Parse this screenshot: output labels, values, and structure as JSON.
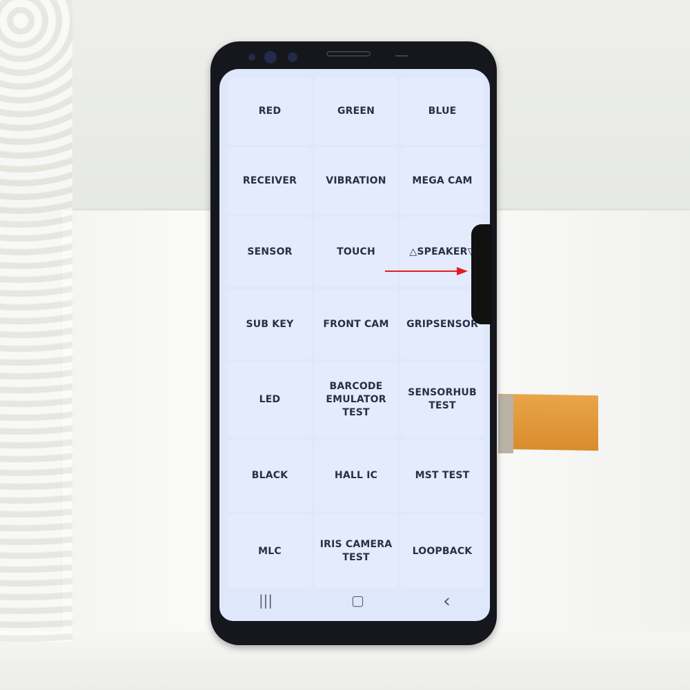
{
  "menu": {
    "items": [
      {
        "label": "RED"
      },
      {
        "label": "GREEN"
      },
      {
        "label": "BLUE"
      },
      {
        "label": "RECEIVER"
      },
      {
        "label": "VIBRATION"
      },
      {
        "label": "MEGA CAM"
      },
      {
        "label": "SENSOR"
      },
      {
        "label": "TOUCH"
      },
      {
        "label": "△SPEAKER▽"
      },
      {
        "label": "SUB KEY"
      },
      {
        "label": "FRONT CAM"
      },
      {
        "label": "GRIPSENSOR"
      },
      {
        "label": "LED"
      },
      {
        "label": "BARCODE EMULATOR TEST"
      },
      {
        "label": "SENSORHUB TEST"
      },
      {
        "label": "BLACK"
      },
      {
        "label": "HALL IC"
      },
      {
        "label": "MST TEST"
      },
      {
        "label": "MLC"
      },
      {
        "label": "IRIS CAMERA TEST"
      },
      {
        "label": "LOOPBACK"
      }
    ]
  },
  "navbar": {
    "recents": "|||",
    "home": "▢",
    "back": "‹"
  },
  "colors": {
    "screen": "#dfe8fb",
    "text": "#2b2e45",
    "annotation_arrow": "#e41c1c"
  }
}
